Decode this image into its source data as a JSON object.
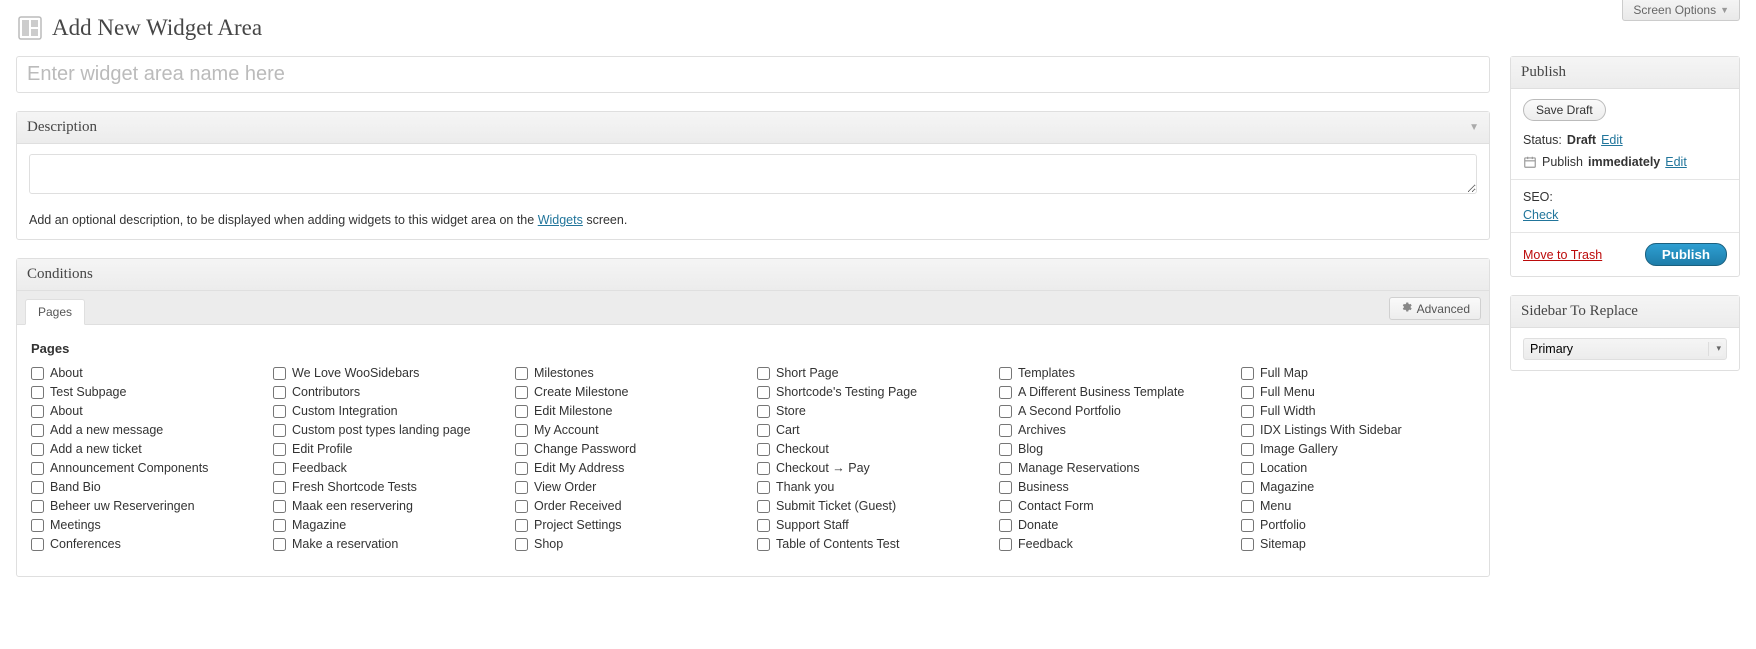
{
  "screen_options_label": "Screen Options",
  "page_title": "Add New Widget Area",
  "title_placeholder": "Enter widget area name here",
  "description": {
    "heading": "Description",
    "hint_prefix": "Add an optional description, to be displayed when adding widgets to this widget area on the ",
    "hint_link": "Widgets",
    "hint_suffix": " screen."
  },
  "conditions": {
    "heading": "Conditions",
    "tab_label": "Pages",
    "advanced_label": "Advanced",
    "section_title": "Pages",
    "columns": [
      [
        "About",
        "Test Subpage",
        "About",
        "Add a new message",
        "Add a new ticket",
        "Announcement Components",
        "Band Bio",
        "Beheer uw Reserveringen",
        "Meetings",
        "Conferences"
      ],
      [
        "We Love WooSidebars",
        "Contributors",
        "Custom Integration",
        "Custom post types landing page",
        "Edit Profile",
        "Feedback",
        "Fresh Shortcode Tests",
        "Maak een reservering",
        "Magazine",
        "Make a reservation"
      ],
      [
        "Milestones",
        "Create Milestone",
        "Edit Milestone",
        "My Account",
        "Change Password",
        "Edit My Address",
        "View Order",
        "Order Received",
        "Project Settings",
        "Shop"
      ],
      [
        "Short Page",
        "Shortcode's Testing Page",
        "Store",
        "Cart",
        "Checkout",
        "Checkout → Pay",
        "Thank you",
        "Submit Ticket (Guest)",
        "Support Staff",
        "Table of Contents Test"
      ],
      [
        "Templates",
        "A Different Business Template",
        "A Second Portfolio",
        "Archives",
        "Blog",
        "Manage Reservations",
        "Business",
        "Contact Form",
        "Donate",
        "Feedback"
      ],
      [
        "Full Map",
        "Full Menu",
        "Full Width",
        "IDX Listings With Sidebar",
        "Image Gallery",
        "Location",
        "Magazine",
        "Menu",
        "Portfolio",
        "Sitemap"
      ]
    ]
  },
  "publish": {
    "heading": "Publish",
    "save_draft": "Save Draft",
    "status_label": "Status:",
    "status_value": "Draft",
    "edit": "Edit",
    "schedule_prefix": "Publish",
    "schedule_value": "immediately",
    "seo_label": "SEO:",
    "seo_link": "Check",
    "trash": "Move to Trash",
    "publish_btn": "Publish"
  },
  "sidebar_replace": {
    "heading": "Sidebar To Replace",
    "selected": "Primary"
  }
}
